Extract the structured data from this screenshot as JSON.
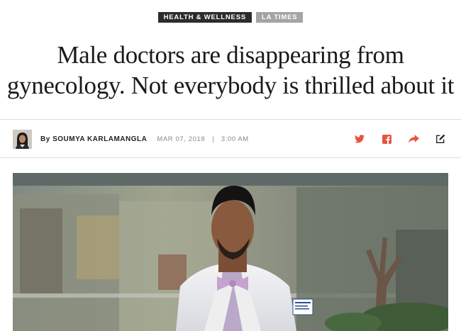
{
  "tags": [
    "HEALTH & WELLNESS",
    "LA TIMES"
  ],
  "headline": "Male doctors are disappearing from gynecology. Not everybody is thrilled about it",
  "byline": {
    "by_label": "By",
    "author": "SOUMYA KARLAMANGLA",
    "date": "MAR 07, 2018",
    "separator": "|",
    "time": "3:00 AM"
  },
  "share_icons": [
    "twitter-icon",
    "facebook-icon",
    "share-arrow-icon",
    "edit-icon"
  ],
  "colors": {
    "share_accent": "#e8533f",
    "tag_dark": "#2c2c2c",
    "tag_gray": "#a4a4a4",
    "headline": "#1a1a1a"
  }
}
